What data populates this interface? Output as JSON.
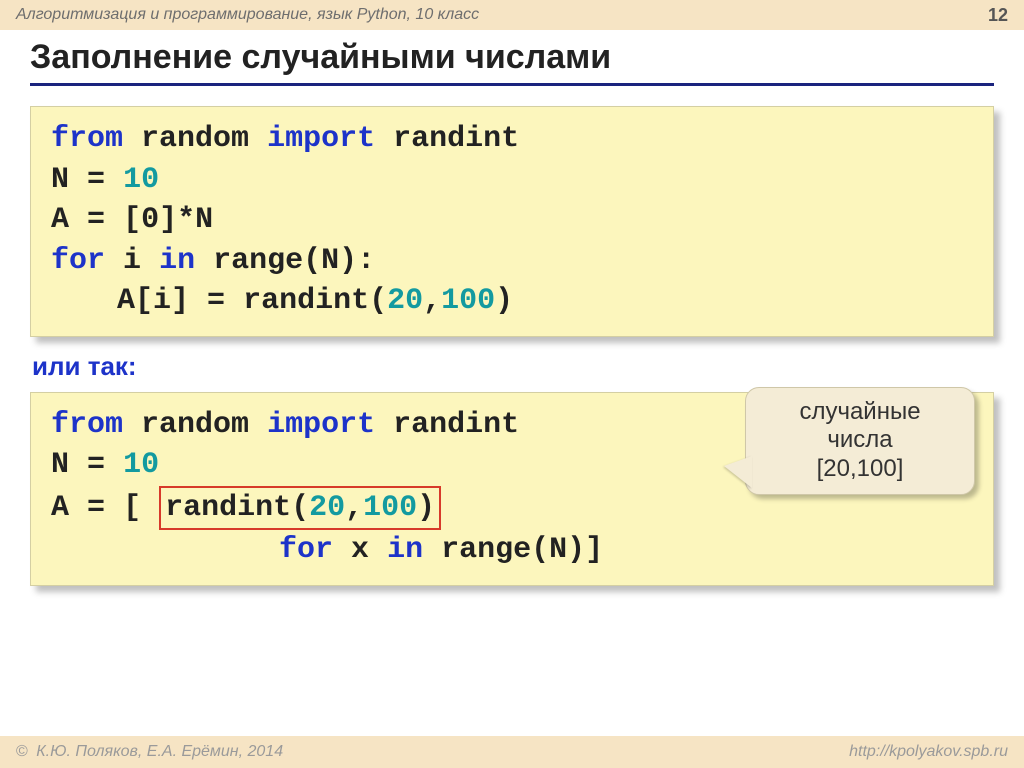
{
  "header": {
    "course": "Алгоритмизация и программирование, язык Python, 10 класс",
    "page": "12"
  },
  "title": "Заполнение случайными числами",
  "code1": {
    "l1": {
      "kw1": "from",
      "mod": "random",
      "kw2": "import",
      "fn": "randint"
    },
    "l2": {
      "lhs": "N",
      "eq": "=",
      "val": "10"
    },
    "l3": {
      "lhs": "A",
      "eq": "=",
      "rhs": "[0]*N"
    },
    "l4": {
      "kw1": "for",
      "var": "i",
      "kw2": "in",
      "fn": "range",
      "arg": "(N):"
    },
    "l5": {
      "lhs": "A[i]",
      "eq": "=",
      "fn": "randint(",
      "a": "20",
      "c": ",",
      "b": "100",
      "close": ")"
    }
  },
  "orLabel": "или так:",
  "code2": {
    "l1": {
      "kw1": "from",
      "mod": "random",
      "kw2": "import",
      "fn": "randint"
    },
    "l2": {
      "lhs": "N",
      "eq": "=",
      "val": "10"
    },
    "l3": {
      "lhs": "A",
      "eq": "=",
      "open": "[",
      "fn": "randint(",
      "a": "20",
      "c": ",",
      "b": "100",
      "close": ")"
    },
    "l4": {
      "kw1": "for",
      "var": "x",
      "kw2": "in",
      "fn": "range",
      "arg": "(N)]"
    }
  },
  "callout": {
    "line1": "случайные",
    "line2": "числа",
    "line3": "[20,100]"
  },
  "footer": {
    "copyright": "К.Ю. Поляков, Е.А. Ерёмин, 2014",
    "url": "http://kpolyakov.spb.ru"
  }
}
